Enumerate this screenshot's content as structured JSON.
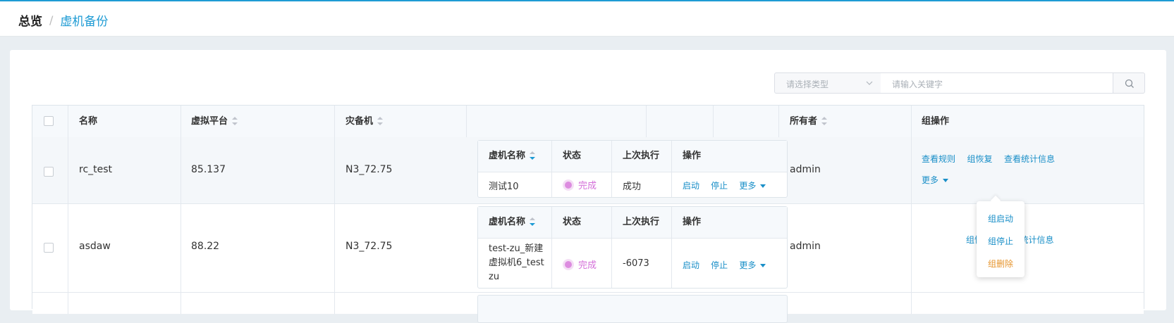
{
  "breadcrumb": {
    "home": "总览",
    "separator": "/",
    "current": "虚机备份"
  },
  "filters": {
    "type_placeholder": "请选择类型",
    "search_placeholder": "请输入关键字"
  },
  "table": {
    "headers": {
      "name": "名称",
      "platform": "虚拟平台",
      "backup": "灾备机",
      "owner": "所有者",
      "group_ops": "组操作"
    },
    "rows": [
      {
        "name": "rc_test",
        "platform": "85.137",
        "backup": "N3_72.75",
        "owner": "admin",
        "vm": {
          "name": "测试10",
          "status": "完成",
          "last": "成功"
        }
      },
      {
        "name": "asdaw",
        "platform": "88.22",
        "backup": "N3_72.75",
        "owner": "admin",
        "vm": {
          "name_line1": "test-zu_新建",
          "name_line2": "虚拟机6_test",
          "name_line3": "zu",
          "status": "完成",
          "last": "-6073"
        }
      }
    ]
  },
  "subtable": {
    "headers": {
      "vm_name": "虚机名称",
      "status": "状态",
      "last_exec": "上次执行",
      "ops": "操作"
    },
    "actions": {
      "start": "启动",
      "stop": "停止",
      "more": "更多"
    }
  },
  "group_actions": {
    "view_rules": "查看规则",
    "restore": "组恢复",
    "stats": "查看统计信息",
    "more": "更多"
  },
  "more_menu": {
    "start": "组启动",
    "stop": "组停止",
    "delete": "组删除"
  },
  "colors": {
    "accent": "#1e9bd4",
    "status_done": "#d470da",
    "danger": "#e6952e"
  }
}
